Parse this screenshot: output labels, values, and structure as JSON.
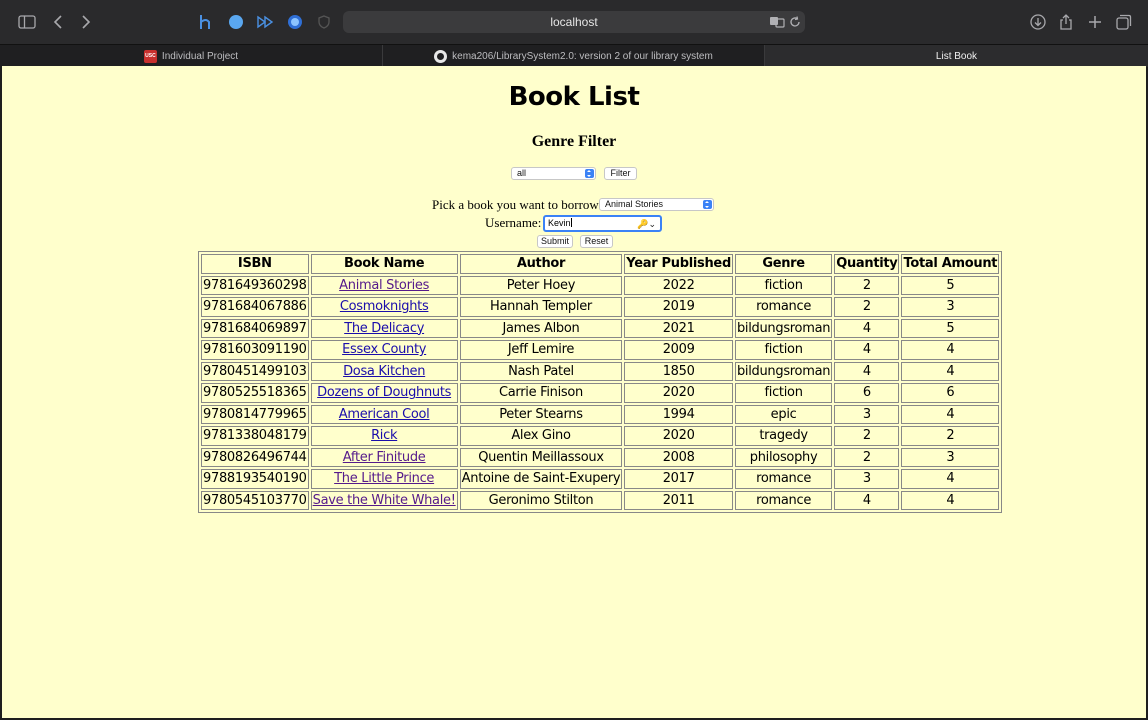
{
  "browser": {
    "address": "localhost",
    "tabs": [
      {
        "label": "Individual Project",
        "favicon": "USC",
        "active": false
      },
      {
        "label": "kema206/LibrarySystem2.0: version 2 of our library system",
        "favicon": "github-icon",
        "active": false
      },
      {
        "label": "List Book",
        "active": true
      }
    ]
  },
  "page": {
    "title": "Book List",
    "genre_heading": "Genre Filter",
    "genre_select_value": "all",
    "filter_label": "Filter",
    "borrow_label": "Pick a book you want to borrow",
    "borrow_select_value": "Animal Stories",
    "username_label": "Username:",
    "username_value": "Kevin",
    "submit_label": "Submit",
    "reset_label": "Reset"
  },
  "table": {
    "headers": [
      "ISBN",
      "Book Name",
      "Author",
      "Year Published",
      "Genre",
      "Quantity",
      "Total Amount"
    ],
    "rows": [
      {
        "isbn": "9781649360298",
        "name": "Animal Stories",
        "author": "Peter Hoey",
        "year": "2022",
        "genre": "fiction",
        "quantity": "2",
        "total": "5",
        "visited": true
      },
      {
        "isbn": "9781684067886",
        "name": "Cosmoknights",
        "author": "Hannah Templer",
        "year": "2019",
        "genre": "romance",
        "quantity": "2",
        "total": "3",
        "visited": false
      },
      {
        "isbn": "9781684069897",
        "name": "The Delicacy",
        "author": "James Albon",
        "year": "2021",
        "genre": "bildungsroman",
        "quantity": "4",
        "total": "5",
        "visited": false
      },
      {
        "isbn": "9781603091190",
        "name": "Essex County",
        "author": "Jeff Lemire",
        "year": "2009",
        "genre": "fiction",
        "quantity": "4",
        "total": "4",
        "visited": false
      },
      {
        "isbn": "9780451499103",
        "name": "Dosa Kitchen",
        "author": "Nash Patel",
        "year": "1850",
        "genre": "bildungsroman",
        "quantity": "4",
        "total": "4",
        "visited": false
      },
      {
        "isbn": "9780525518365",
        "name": "Dozens of Doughnuts",
        "author": "Carrie Finison",
        "year": "2020",
        "genre": "fiction",
        "quantity": "6",
        "total": "6",
        "visited": false
      },
      {
        "isbn": "9780814779965",
        "name": "American Cool",
        "author": "Peter Stearns",
        "year": "1994",
        "genre": "epic",
        "quantity": "3",
        "total": "4",
        "visited": false
      },
      {
        "isbn": "9781338048179",
        "name": "Rick",
        "author": "Alex Gino",
        "year": "2020",
        "genre": "tragedy",
        "quantity": "2",
        "total": "2",
        "visited": false
      },
      {
        "isbn": "9780826496744",
        "name": "After Finitude",
        "author": "Quentin Meillassoux",
        "year": "2008",
        "genre": "philosophy",
        "quantity": "2",
        "total": "3",
        "visited": true
      },
      {
        "isbn": "9788193540190",
        "name": "The Little Prince",
        "author": "Antoine de Saint-Exupery",
        "year": "2017",
        "genre": "romance",
        "quantity": "3",
        "total": "4",
        "visited": true
      },
      {
        "isbn": "9780545103770",
        "name": "Save the White Whale!",
        "author": "Geronimo Stilton",
        "year": "2011",
        "genre": "romance",
        "quantity": "4",
        "total": "4",
        "visited": true
      }
    ]
  },
  "colors": {
    "page_background": "#ffffcc",
    "link": "#1a0dab",
    "visited_link": "#551a8b",
    "focus": "#3b82f6"
  }
}
